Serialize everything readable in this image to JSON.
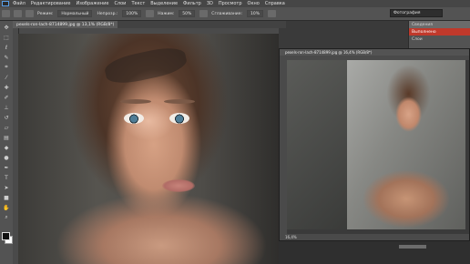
{
  "menubar": {
    "items": [
      "Файл",
      "Редактирование",
      "Изображение",
      "Слои",
      "Текст",
      "Выделение",
      "Фильтр",
      "3D",
      "Просмотр",
      "Окно",
      "Справка"
    ]
  },
  "options": {
    "labels": [
      "Режим:",
      "Нормальный",
      "Непрозр.:",
      "Нажим:",
      "Сглаживание:"
    ],
    "values": [
      "100%",
      "50%",
      "10%"
    ],
    "workspace": "Фотография"
  },
  "tabs": {
    "main": "pexels-ron-lach-8714899.jpg @ 13,1% (RGB/8*)"
  },
  "float_window": {
    "title": "pexels-ron-lach-8714899.jpg @ 16,4% (RGB/8*)",
    "status": "16,4%"
  },
  "right_panel": {
    "rows": [
      "Сведения",
      "Выполнено",
      "Слои"
    ]
  },
  "colors": {
    "accent": "#c0392b",
    "chrome": "#535353"
  },
  "tools": [
    "move-icon",
    "marquee-icon",
    "lasso-icon",
    "quick-select-icon",
    "crop-icon",
    "eyedropper-icon",
    "healing-icon",
    "brush-icon",
    "clone-stamp-icon",
    "history-brush-icon",
    "eraser-icon",
    "gradient-icon",
    "blur-icon",
    "dodge-icon",
    "pen-icon",
    "type-icon",
    "path-select-icon",
    "shape-icon",
    "hand-icon",
    "zoom-icon"
  ]
}
